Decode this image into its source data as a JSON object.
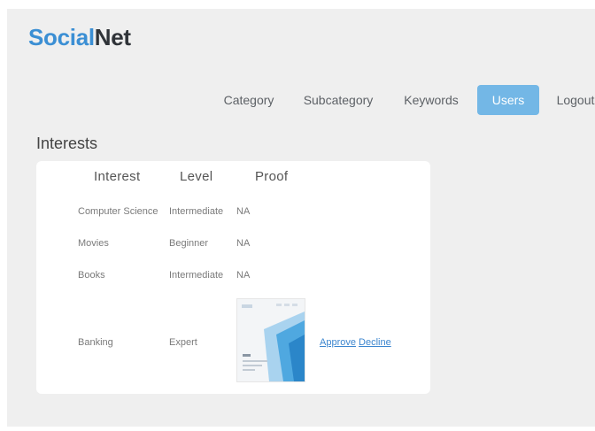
{
  "brand": {
    "part1": "Social",
    "part2": "Net"
  },
  "nav": {
    "category": "Category",
    "subcategory": "Subcategory",
    "keywords": "Keywords",
    "users": "Users",
    "logout": "Logout",
    "active": "Users"
  },
  "section_title": "Interests",
  "table": {
    "headers": [
      "Interest",
      "Level",
      "Proof"
    ],
    "rows": [
      {
        "interest": "Computer Science",
        "level": "Intermediate",
        "proof": "NA"
      },
      {
        "interest": "Movies",
        "level": "Beginner",
        "proof": "NA"
      },
      {
        "interest": "Books",
        "level": "Intermediate",
        "proof": "NA"
      },
      {
        "interest": "Banking",
        "level": "Expert",
        "proof": "image"
      }
    ]
  },
  "actions": {
    "approve": "Approve",
    "decline": "Decline"
  },
  "colors": {
    "accent": "#3b8fd4",
    "active_tab": "#73b7e6",
    "link": "#3c86cf",
    "background": "#efefef"
  }
}
